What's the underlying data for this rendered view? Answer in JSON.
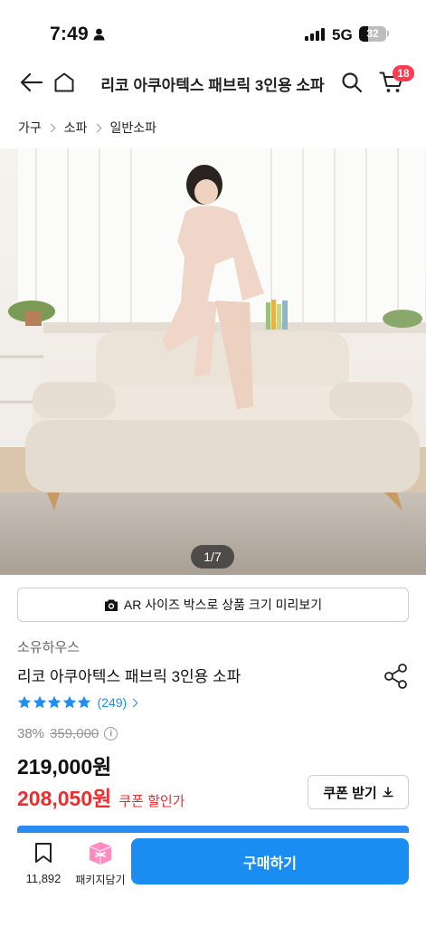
{
  "status_bar": {
    "time": "7:49",
    "network": "5G",
    "battery_text": "32",
    "battery_level": 0.32
  },
  "nav": {
    "title": "리코 아쿠아텍스 패브릭 3인용 소파",
    "cart_count": "18",
    "icons": [
      "back-arrow-icon",
      "home-icon",
      "search-icon",
      "cart-icon"
    ]
  },
  "breadcrumb": [
    "가구",
    "소파",
    "일반소파"
  ],
  "gallery": {
    "counter": "1/7"
  },
  "ar_button": {
    "label": "AR 사이즈 박스로 상품 크기 미리보기",
    "icon": "camera-icon"
  },
  "product": {
    "brand": "소유하우스",
    "name": "리코 아쿠아텍스 패브릭 3인용 소파",
    "rating_stars": 5,
    "review_count": "(249)",
    "discount_rate": "38%",
    "original_price": "359,000",
    "price": "219,000원",
    "coupon_price": "208,050원",
    "coupon_price_label": "쿠폰 할인가"
  },
  "coupon_button": {
    "label": "쿠폰 받기"
  },
  "bottom_bar": {
    "bookmark_count": "11,892",
    "package_label": "패키지담기",
    "buy_label": "구매하기"
  },
  "colors": {
    "accent_blue": "#1a8df3",
    "rating_blue": "#1f8ef1",
    "sale_red": "#ef2d2d",
    "badge_red": "#ff3b4f",
    "package_pink": "#ff8bc1"
  }
}
